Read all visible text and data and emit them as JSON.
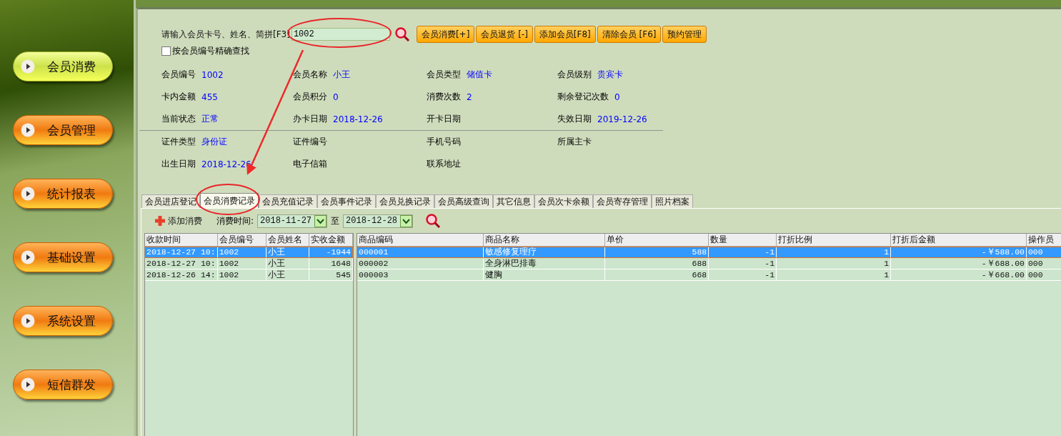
{
  "nav": {
    "items": [
      {
        "label": "会员消费",
        "selected": true
      },
      {
        "label": "会员管理",
        "selected": false
      },
      {
        "label": "统计报表",
        "selected": false
      },
      {
        "label": "基础设置",
        "selected": false
      },
      {
        "label": "系统设置",
        "selected": false
      },
      {
        "label": "短信群发",
        "selected": false
      }
    ]
  },
  "search": {
    "label": "请输入会员卡号、姓名、简拼[F3]",
    "value": "1002",
    "exact_match": {
      "label": "按会员编号精确查找",
      "checked": false
    }
  },
  "buttons": [
    "会员消费[+]",
    "会员退货 [-]",
    "添加会员[F8]",
    "清除会员 [F6]",
    "预约管理"
  ],
  "member_info": [
    {
      "fields": [
        {
          "label": "会员编号",
          "value": "1002"
        },
        {
          "label": "会员名称",
          "value": "小王"
        },
        {
          "label": "会员类型",
          "value": "储值卡"
        },
        {
          "label": "会员级别",
          "value": "贵宾卡"
        },
        {
          "label": "卡内金额",
          "value": "455"
        },
        {
          "label": "会员积分",
          "value": "0"
        },
        {
          "label": "消费次数",
          "value": "2"
        },
        {
          "label": "剩余登记次数",
          "value": "0"
        },
        {
          "label": "当前状态",
          "value": "正常"
        },
        {
          "label": "办卡日期",
          "value": "2018-12-26"
        },
        {
          "label": "开卡日期"
        },
        {
          "label": "失效日期",
          "value": "2019-12-26"
        }
      ]
    },
    {
      "fields": [
        {
          "label": "证件类型",
          "value": "身份证"
        },
        {
          "label": "证件编号"
        },
        {
          "label": "手机号码"
        },
        {
          "label": "所属主卡"
        },
        {
          "label": "出生日期",
          "value": "2018-12-26"
        },
        {
          "label": "电子信箱"
        },
        {
          "label": "联系地址"
        }
      ]
    }
  ],
  "tabs": [
    {
      "label": "会员进店登记",
      "selected": false
    },
    {
      "label": "会员消费记录",
      "selected": true
    },
    {
      "label": "会员充值记录",
      "selected": false
    },
    {
      "label": "会员事件记录",
      "selected": false
    },
    {
      "label": "会员兑换记录",
      "selected": false
    },
    {
      "label": "会员高级查询",
      "selected": false
    },
    {
      "label": "其它信息",
      "selected": false
    },
    {
      "label": "会员次卡余额",
      "selected": false
    },
    {
      "label": "会员寄存管理",
      "selected": false
    },
    {
      "label": "照片档案",
      "selected": false
    }
  ],
  "toolbar": {
    "add_button": "添加消费",
    "date_label": "消费时间:",
    "date_from": "2018-11-27",
    "to_label": "至",
    "date_to": "2018-12-28"
  },
  "orders_table": {
    "columns": [
      "收款时间",
      "会员编号",
      "会员姓名",
      "实收金额"
    ],
    "rows": [
      {
        "cells": [
          "2018-12-27 10:",
          "1002",
          "小王",
          "-1944"
        ],
        "selected": true
      },
      {
        "cells": [
          "2018-12-27 10:",
          "1002",
          "小王",
          "1648"
        ],
        "selected": false
      },
      {
        "cells": [
          "2018-12-26 14:",
          "1002",
          "小王",
          "545"
        ],
        "selected": false
      }
    ]
  },
  "items_table": {
    "columns": [
      "商品编码",
      "商品名称",
      "单价",
      "数量",
      "打折比例",
      "打折后金额",
      "操作员"
    ],
    "rows": [
      {
        "cells": [
          "000001",
          "敏感修复理疗",
          "588",
          "-1",
          "1",
          "-￥588.00",
          "000"
        ],
        "selected": true
      },
      {
        "cells": [
          "000002",
          "全身淋巴排毒",
          "688",
          "-1",
          "1",
          "-￥688.00",
          "000"
        ],
        "selected": false
      },
      {
        "cells": [
          "000003",
          "健胸",
          "668",
          "-1",
          "1",
          "-￥668.00",
          "000"
        ],
        "selected": false
      }
    ]
  }
}
